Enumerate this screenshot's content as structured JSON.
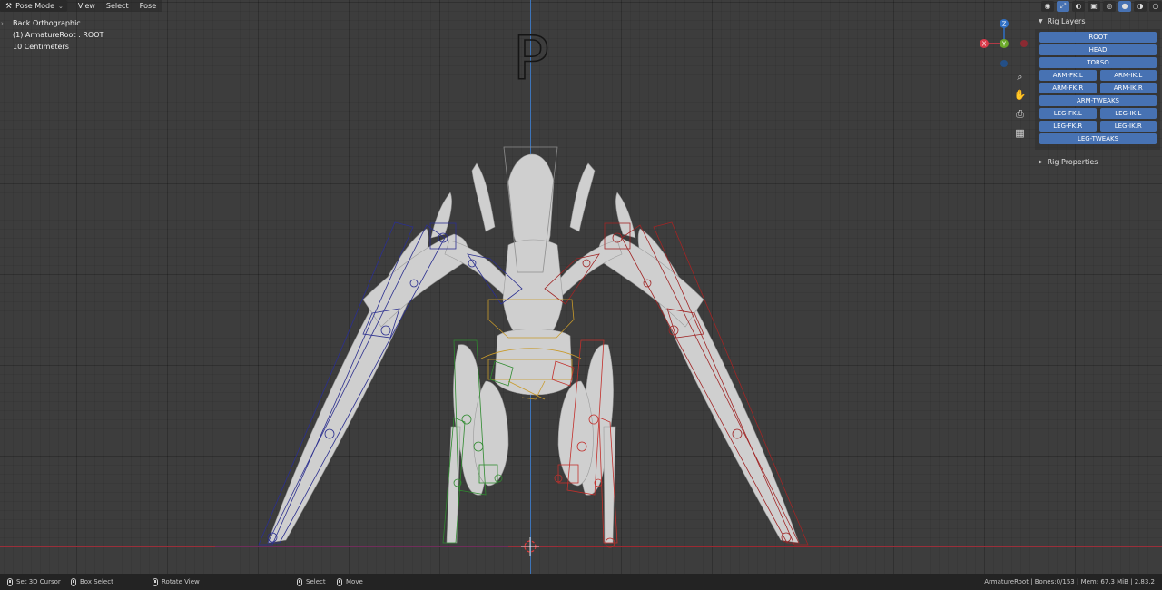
{
  "header": {
    "mode_label": "Pose Mode",
    "menus": [
      "View",
      "Select",
      "Pose"
    ]
  },
  "overlay": {
    "view_name": "Back Orthographic",
    "object_info": "(1) ArmatureRoot : ROOT",
    "scale": "10 Centimeters",
    "big_letter": "P"
  },
  "gizmo": {
    "z": "Z",
    "y": "Y",
    "x": "X"
  },
  "sidebar": {
    "rig_layers_title": "Rig Layers",
    "layers": {
      "root": "ROOT",
      "head": "HEAD",
      "torso": "TORSO",
      "arm_fk_l": "ARM-FK.L",
      "arm_ik_l": "ARM-IK.L",
      "arm_fk_r": "ARM-FK.R",
      "arm_ik_r": "ARM-IK.R",
      "arm_tweaks": "ARM-TWEAKS",
      "leg_fk_l": "LEG-FK.L",
      "leg_ik_l": "LEG-IK.L",
      "leg_fk_r": "LEG-FK.R",
      "leg_ik_r": "LEG-IK.R",
      "leg_tweaks": "LEG-TWEAKS"
    },
    "rig_properties_title": "Rig Properties"
  },
  "statusbar": {
    "set_cursor": "Set 3D Cursor",
    "box_select": "Box Select",
    "rotate_view": "Rotate View",
    "select": "Select",
    "move": "Move",
    "stats": "ArmatureRoot | Bones:0/153 | Mem: 67.3 MiB | 2.83.2"
  },
  "colors": {
    "layer_button": "#4772b3",
    "bone_left": "#2b2f8f",
    "bone_right": "#a02525",
    "bone_green": "#2f8a2f",
    "bone_torso": "#c89a2a",
    "axis_x": "#9a2f3a",
    "axis_z": "#3d74b8"
  }
}
